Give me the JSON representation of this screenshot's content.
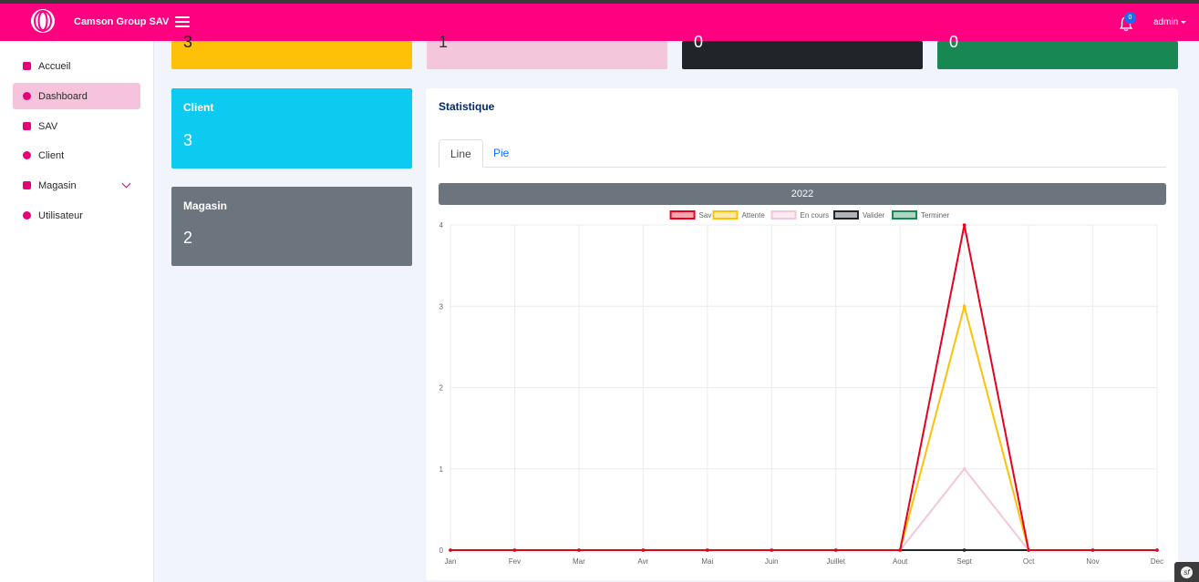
{
  "header": {
    "brand": "Camson Group SAV",
    "notification_count": "0",
    "user": "admin",
    "bg_color": "#ff0080"
  },
  "sidebar": {
    "items": [
      {
        "label": "Accueil",
        "icon": "home-icon"
      },
      {
        "label": "Dashboard",
        "icon": "dashboard-icon",
        "active": true
      },
      {
        "label": "SAV",
        "icon": "sav-icon"
      },
      {
        "label": "Client",
        "icon": "person-icon"
      },
      {
        "label": "Magasin",
        "icon": "store-icon",
        "expandable": true
      },
      {
        "label": "Utilisateur",
        "icon": "user-settings-icon"
      }
    ]
  },
  "cards": {
    "top": [
      {
        "value": "3",
        "color": "#ffc107"
      },
      {
        "value": "1",
        "color": "#f3c6dc"
      },
      {
        "value": "0",
        "color": "#212529"
      },
      {
        "value": "0",
        "color": "#198754"
      }
    ],
    "client": {
      "title": "Client",
      "value": "3",
      "color": "#0dcaf0"
    },
    "magasin": {
      "title": "Magasin",
      "value": "2",
      "color": "#6c757d"
    }
  },
  "statistique": {
    "title": "Statistique",
    "tabs": [
      {
        "label": "Line",
        "active": true
      },
      {
        "label": "Pie"
      }
    ],
    "year": "2022"
  },
  "chart_data": {
    "type": "line",
    "title": "2022",
    "categories": [
      "Jan",
      "Fev",
      "Mar",
      "Avr",
      "Mai",
      "Juin",
      "Juillet",
      "Aout",
      "Sept",
      "Oct",
      "Nov",
      "Dec"
    ],
    "ylim": [
      0,
      4
    ],
    "yticks": [
      "0",
      "1",
      "2",
      "3",
      "4"
    ],
    "grid": true,
    "legend_position": "top",
    "series": [
      {
        "name": "Sav",
        "color": "#e8001c",
        "values": [
          0,
          0,
          0,
          0,
          0,
          0,
          0,
          0,
          4,
          0,
          0,
          0
        ]
      },
      {
        "name": "Attente",
        "color": "#ffc107",
        "values": [
          0,
          0,
          0,
          0,
          0,
          0,
          0,
          0,
          3,
          0,
          0,
          0
        ]
      },
      {
        "name": "En cours",
        "color": "#f3c6dc",
        "values": [
          0,
          0,
          0,
          0,
          0,
          0,
          0,
          0,
          1,
          0,
          0,
          0
        ]
      },
      {
        "name": "Valider",
        "color": "#212529",
        "values": [
          0,
          0,
          0,
          0,
          0,
          0,
          0,
          0,
          0,
          0,
          0,
          0
        ]
      },
      {
        "name": "Terminer",
        "color": "#198754",
        "values": [
          0,
          0,
          0,
          0,
          0,
          0,
          0,
          0,
          0,
          0,
          0,
          0
        ]
      }
    ]
  }
}
